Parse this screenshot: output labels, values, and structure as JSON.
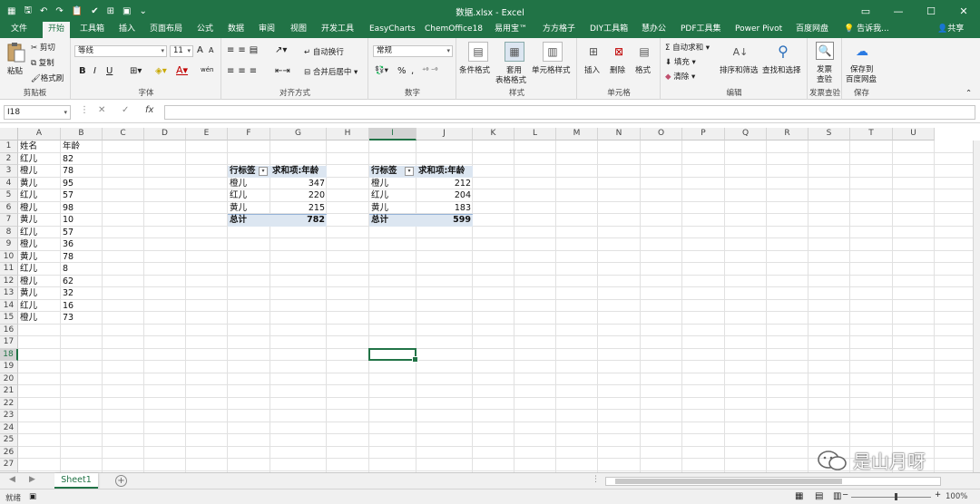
{
  "app": {
    "title": "数据.xlsx - Excel",
    "accent": "#217346"
  },
  "qat": [
    "save-icon",
    "undo-icon",
    "redo-icon",
    "paste-icon",
    "format-painter-icon",
    "table-icon",
    "preview-icon",
    "more-icon"
  ],
  "tabs": [
    "文件",
    "开始",
    "工具箱",
    "插入",
    "页面布局",
    "公式",
    "数据",
    "审阅",
    "视图",
    "开发工具",
    "EasyCharts",
    "ChemOffice18",
    "易用宝™",
    "方方格子",
    "DIY工具箱",
    "慧办公",
    "PDF工具集",
    "Power Pivot",
    "百度网盘"
  ],
  "active_tab": "开始",
  "tell_me": "告诉我...",
  "share": "共享",
  "ribbon": {
    "clipboard": {
      "label": "剪贴板",
      "paste": "粘贴",
      "cut": "剪切",
      "copy": "复制",
      "painter": "格式刷"
    },
    "font": {
      "label": "字体",
      "name": "等线",
      "size": "11",
      "grow": "A",
      "shrink": "A",
      "bold": "B",
      "italic": "I",
      "underline": "U",
      "wen": "wén"
    },
    "alignment": {
      "label": "对齐方式",
      "wrap": "自动换行",
      "merge": "合并后居中"
    },
    "number": {
      "label": "数字",
      "format": "常规",
      "percent": "%",
      "comma": ","
    },
    "styles": {
      "label": "样式",
      "conditional": "条件格式",
      "table_1": "套用",
      "table_2": "表格格式",
      "cell_styles": "单元格样式"
    },
    "cells": {
      "label": "单元格",
      "insert": "插入",
      "delete": "删除",
      "format": "格式"
    },
    "editing": {
      "label": "编辑",
      "autosum": "自动求和",
      "fill": "填充",
      "clear": "清除",
      "sort": "排序和筛选",
      "find": "查找和选择"
    },
    "invoice": {
      "label": "发票查验",
      "btn_1": "发票",
      "btn_2": "查验"
    },
    "save": {
      "label": "保存",
      "btn_1": "保存到",
      "btn_2": "百度网盘"
    }
  },
  "formula_bar": {
    "name_box": "I18",
    "cancel": "✕",
    "enter": "✓",
    "fx": "fx",
    "value": ""
  },
  "columns": [
    "A",
    "B",
    "C",
    "D",
    "E",
    "F",
    "G",
    "H",
    "I",
    "J",
    "K",
    "L",
    "M",
    "N",
    "O",
    "P",
    "Q",
    "R",
    "S",
    "T",
    "U"
  ],
  "rows": [
    "1",
    "2",
    "3",
    "4",
    "5",
    "6",
    "7",
    "8",
    "9",
    "10",
    "11",
    "12",
    "13",
    "14",
    "15",
    "16",
    "17",
    "18",
    "19",
    "20",
    "21",
    "22",
    "23",
    "24",
    "25",
    "26",
    "27",
    "28"
  ],
  "selected": {
    "col": "I",
    "row": "18"
  },
  "table": {
    "headers": [
      "姓名",
      "年龄"
    ],
    "rows": [
      [
        "红儿",
        "82"
      ],
      [
        "橙儿",
        "78"
      ],
      [
        "黄儿",
        "95"
      ],
      [
        "红儿",
        "57"
      ],
      [
        "橙儿",
        "98"
      ],
      [
        "黄儿",
        "10"
      ],
      [
        "红儿",
        "57"
      ],
      [
        "橙儿",
        "36"
      ],
      [
        "黄儿",
        "78"
      ],
      [
        "红儿",
        "8"
      ],
      [
        "橙儿",
        "62"
      ],
      [
        "黄儿",
        "32"
      ],
      [
        "红儿",
        "16"
      ],
      [
        "橙儿",
        "73"
      ]
    ]
  },
  "pivot1": {
    "header_label": "行标签",
    "header_value": "求和项:年龄",
    "rows": [
      [
        "橙儿",
        "347"
      ],
      [
        "红儿",
        "220"
      ],
      [
        "黄儿",
        "215"
      ]
    ],
    "total_label": "总计",
    "total_value": "782"
  },
  "pivot2": {
    "header_label": "行标签",
    "header_value": "求和项:年龄",
    "rows": [
      [
        "橙儿",
        "212"
      ],
      [
        "红儿",
        "204"
      ],
      [
        "黄儿",
        "183"
      ]
    ],
    "total_label": "总计",
    "total_value": "599"
  },
  "sheet_tabs": [
    "Sheet1"
  ],
  "status": {
    "ready": "就绪",
    "zoom": "100%"
  },
  "watermark": "是山月呀"
}
